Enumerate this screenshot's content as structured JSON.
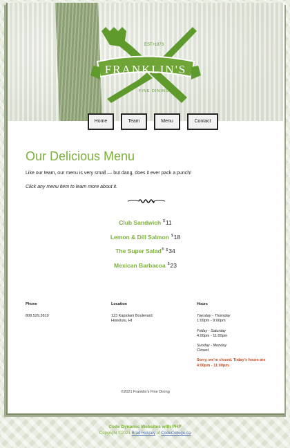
{
  "brand": {
    "name": "FRANKLIN'S",
    "established": "EST.•1973",
    "tagline": "FINE DINING",
    "accent": "#7caf3b"
  },
  "nav": {
    "items": [
      {
        "label": "Home"
      },
      {
        "label": "Team"
      },
      {
        "label": "Menu"
      },
      {
        "label": "Contact"
      }
    ]
  },
  "page": {
    "title": "Our Delicious Menu",
    "intro": "Like our team, our menu is very small — but dang, does it ever pack a punch!",
    "hint": "Click any menu item to learn more about it."
  },
  "menu": {
    "currency": "$",
    "items": [
      {
        "name": "Club Sandwich",
        "reg": "",
        "price": "11"
      },
      {
        "name": "Lemon & Dill Salmon",
        "reg": "",
        "price": "18"
      },
      {
        "name": "The Super Salad",
        "reg": "®",
        "price": "34"
      },
      {
        "name": "Mexican Barbacoa",
        "reg": "",
        "price": "23"
      }
    ]
  },
  "contact": {
    "phone_heading": "Phone",
    "phone": "808.529.3819",
    "location_heading": "Location",
    "address_line1": "123 Kapiolani Boulevard",
    "address_line2": "Honolulu, HI",
    "hours_heading": "Hours",
    "hours": [
      {
        "days": "Tuesday - Thursday",
        "time": "1:00pm - 9:00pm"
      },
      {
        "days": "Friday - Saturday",
        "time": "4:00pm - 11:00pm"
      },
      {
        "days": "Sunday - Monday",
        "time": "Closed"
      }
    ],
    "status": "Sorry, we're closed. Today's hours are 4:00pm - 11:00pm."
  },
  "copyright": "©2021 Franklin's Fine Dining",
  "footer": {
    "heading": "Code Dynamic Websites with PHP",
    "copy_prefix": "Copyright ©2021",
    "author": "Brad Hussey",
    "of": "of",
    "site": "CodeCollege.ca"
  }
}
